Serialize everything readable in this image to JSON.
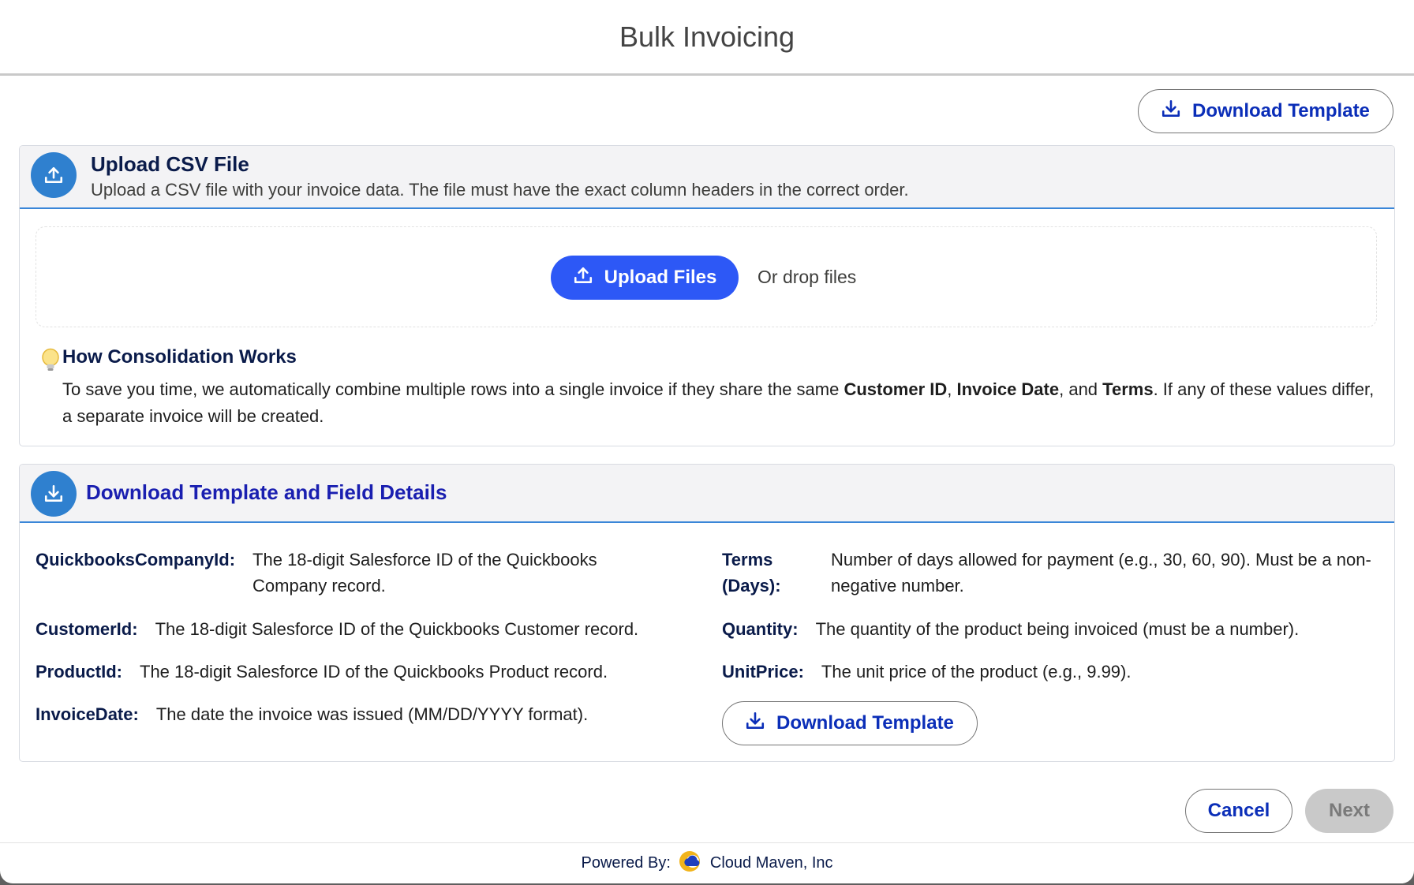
{
  "modal": {
    "title": "Bulk Invoicing"
  },
  "top_action": {
    "download_template_label": "Download Template"
  },
  "upload_section": {
    "title": "Upload CSV File",
    "subtitle": "Upload a CSV file with your invoice data. The file must have the exact column headers in the correct order.",
    "upload_button_label": "Upload Files",
    "drop_text": "Or drop files",
    "consolidation": {
      "title": "How Consolidation Works",
      "text_intro": "To save you time, we automatically combine multiple rows into a single invoice if they share the same ",
      "key1": "Customer ID",
      "sep1": ", ",
      "key2": "Invoice Date",
      "sep2": ", and ",
      "key3": "Terms",
      "text_outro": ". If any of these values differ, a separate invoice will be created."
    }
  },
  "template_section": {
    "title": "Download Template and Field Details",
    "fields_left": [
      {
        "label": "QuickbooksCompanyId:",
        "desc": "The 18-digit Salesforce ID of the Quickbooks Company record."
      },
      {
        "label": "CustomerId:",
        "desc": "The 18-digit Salesforce ID of the Quickbooks Customer record."
      },
      {
        "label": "ProductId:",
        "desc": "The 18-digit Salesforce ID of the Quickbooks Product record."
      },
      {
        "label": "InvoiceDate:",
        "desc": "The date the invoice was issued (MM/DD/YYYY format)."
      }
    ],
    "fields_right": [
      {
        "label": "Terms (Days):",
        "desc": "Number of days allowed for payment (e.g., 30, 60, 90). Must be a non-negative number."
      },
      {
        "label": "Quantity:",
        "desc": "The quantity of the product being invoiced (must be a number)."
      },
      {
        "label": "UnitPrice:",
        "desc": "The unit price of the product (e.g., 9.99)."
      }
    ],
    "download_template_label": "Download Template"
  },
  "footer_actions": {
    "cancel_label": "Cancel",
    "next_label": "Next"
  },
  "powered_by": {
    "prefix": "Powered By:",
    "company": "Cloud Maven, Inc"
  },
  "colors": {
    "brand_blue": "#2d58f6",
    "title_navy": "#0a1b4a",
    "link_blue": "#0b2eb8",
    "accent_line": "#3a86d8"
  }
}
